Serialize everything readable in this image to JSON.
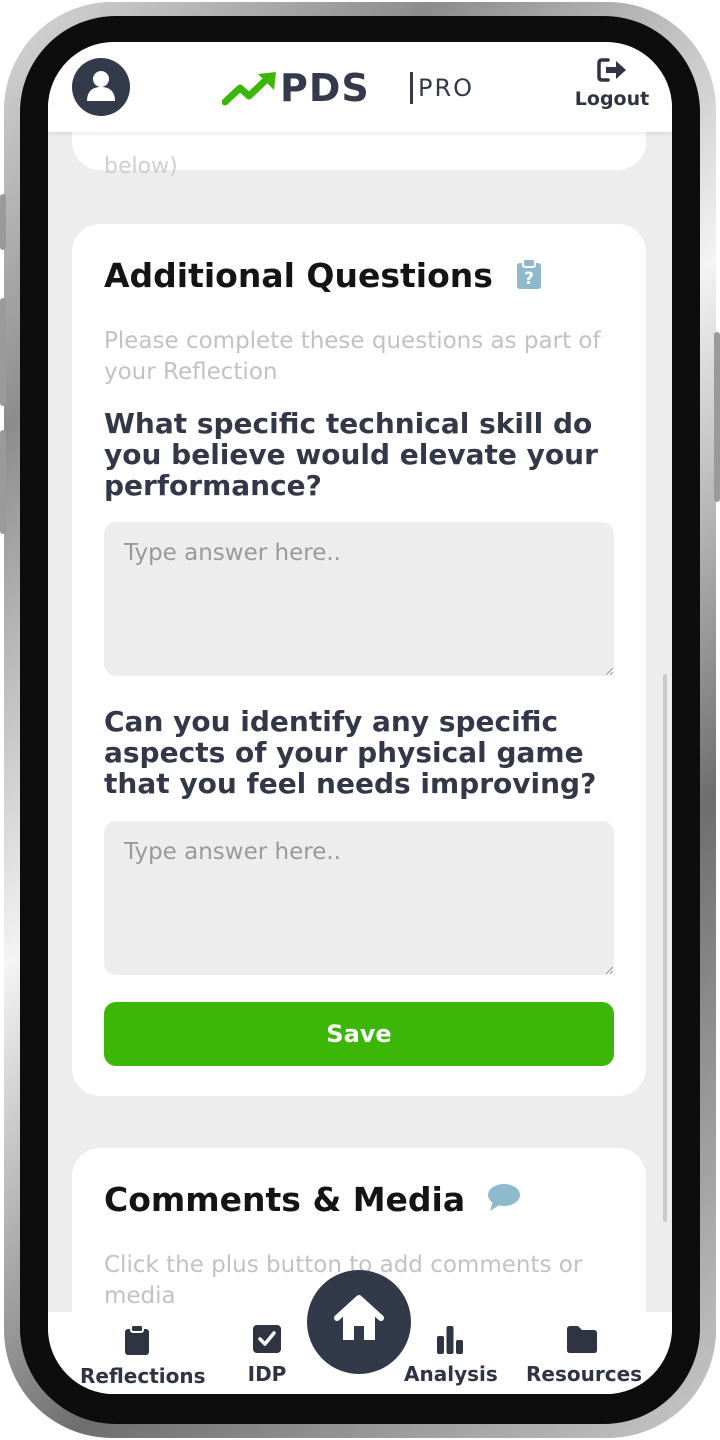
{
  "header": {
    "logo_main": "PDS",
    "logo_sub": "PRO",
    "logout_label": "Logout"
  },
  "previous_card": {
    "partial_text": "below)"
  },
  "additional_questions": {
    "title": "Additional Questions",
    "subtitle": "Please complete these questions as part of your Reflection",
    "questions": [
      {
        "label": "What specific technical skill do you believe would elevate your performance?",
        "placeholder": "Type answer here..",
        "value": ""
      },
      {
        "label": "Can you identify any specific aspects of your physical game that you feel needs improving?",
        "placeholder": "Type answer here..",
        "value": ""
      }
    ],
    "save_label": "Save"
  },
  "comments_media": {
    "title": "Comments & Media",
    "subtitle": "Click the plus button to add comments or media"
  },
  "bottom_nav": {
    "items": [
      {
        "label": "Reflections",
        "icon": "clipboard-icon"
      },
      {
        "label": "IDP",
        "icon": "checkbox-icon"
      },
      {
        "label": "Home",
        "icon": "home-icon"
      },
      {
        "label": "Analysis",
        "icon": "bar-chart-icon"
      },
      {
        "label": "Resources",
        "icon": "folder-icon"
      }
    ]
  },
  "colors": {
    "brand_green": "#3cb707",
    "navy": "#323a4a",
    "help_icon": "#8fb9cc",
    "background": "#ededed"
  }
}
